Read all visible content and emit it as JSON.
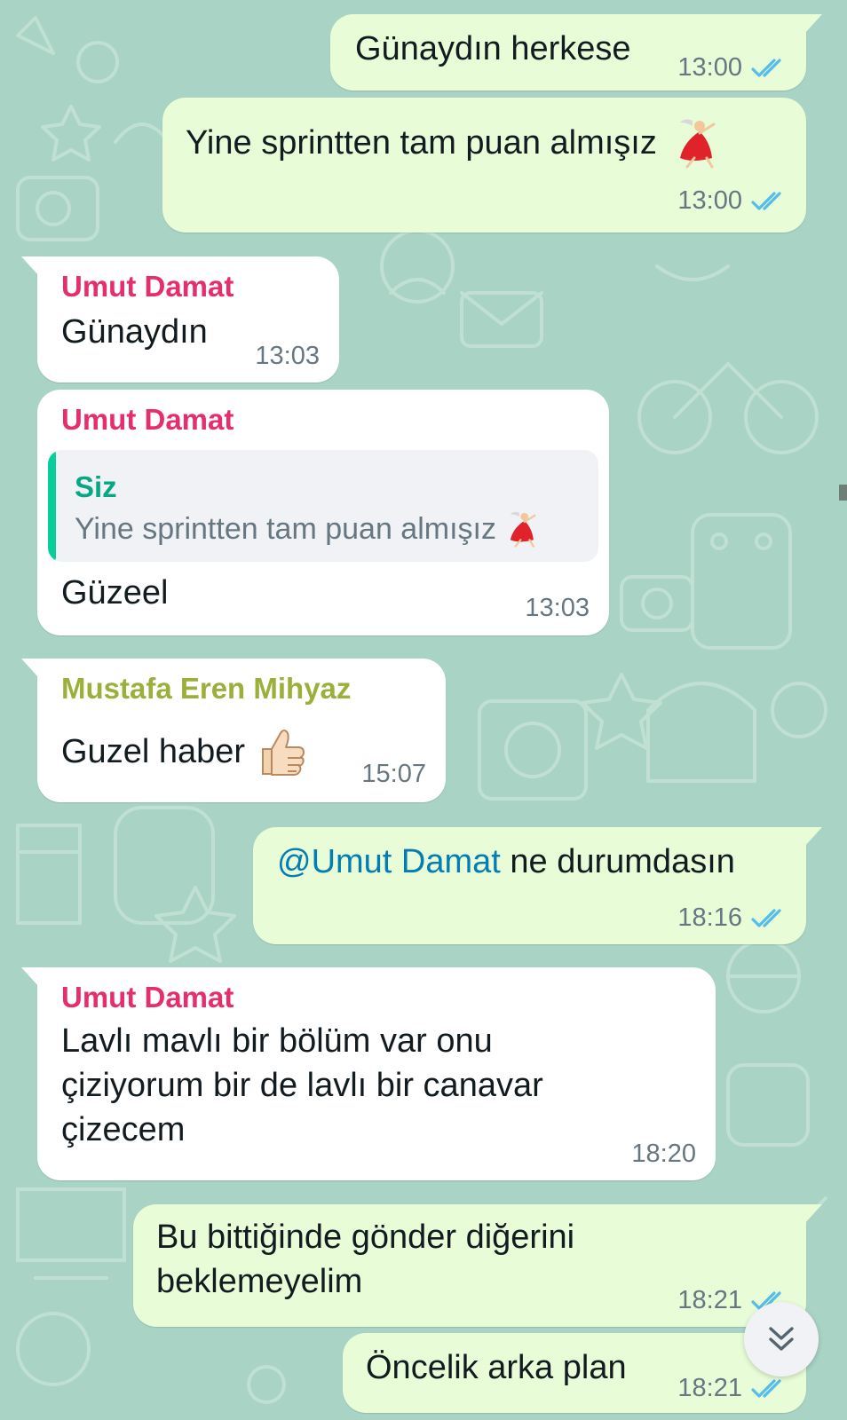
{
  "colors": {
    "wallpaper": "#a9d3c4",
    "outgoing_bubble": "#e8fcd8",
    "incoming_bubble": "#ffffff",
    "read_ticks": "#53bdeb",
    "sender_umut": "#e52e6b",
    "sender_mustafa": "#9bb03a",
    "quote_sender": "#06a884",
    "mention": "#027eb5"
  },
  "messages": [
    {
      "direction": "out",
      "text": "Günaydın herkese",
      "time": "13:00",
      "status": "read-ticks-icon"
    },
    {
      "direction": "out",
      "text": "Yine sprintten tam puan almışız",
      "emoji": "woman-dancing-icon",
      "time": "13:00",
      "status": "read-ticks-icon"
    },
    {
      "direction": "in",
      "sender": "Umut Damat",
      "text": "Günaydın",
      "time": "13:03"
    },
    {
      "direction": "in",
      "sender": "Umut Damat",
      "quote": {
        "sender": "Siz",
        "text": "Yine sprintten tam puan almışız",
        "emoji": "woman-dancing-icon"
      },
      "text": "Güzeel",
      "time": "13:03"
    },
    {
      "direction": "in",
      "sender": "Mustafa Eren Mihyaz",
      "text": "Guzel haber",
      "emoji": "thumbs-up-icon",
      "time": "15:07"
    },
    {
      "direction": "out",
      "mention": "@Umut Damat",
      "text": " ne durumdasın",
      "time": "18:16",
      "status": "read-ticks-icon"
    },
    {
      "direction": "in",
      "sender": "Umut Damat",
      "lines": [
        "Lavlı mavlı bir bölüm var onu",
        "çiziyorum bir de lavlı bir canavar",
        "çizecem"
      ],
      "time": "18:20"
    },
    {
      "direction": "out",
      "lines": [
        "Bu bittiğinde gönder diğerini",
        "beklemeyelim"
      ],
      "time": "18:21",
      "status": "read-ticks-icon"
    },
    {
      "direction": "out",
      "text": "Öncelik arka plan",
      "time": "18:21",
      "status": "read-ticks-icon"
    }
  ],
  "scroll_button": {
    "icon": "double-chevron-down-icon"
  }
}
